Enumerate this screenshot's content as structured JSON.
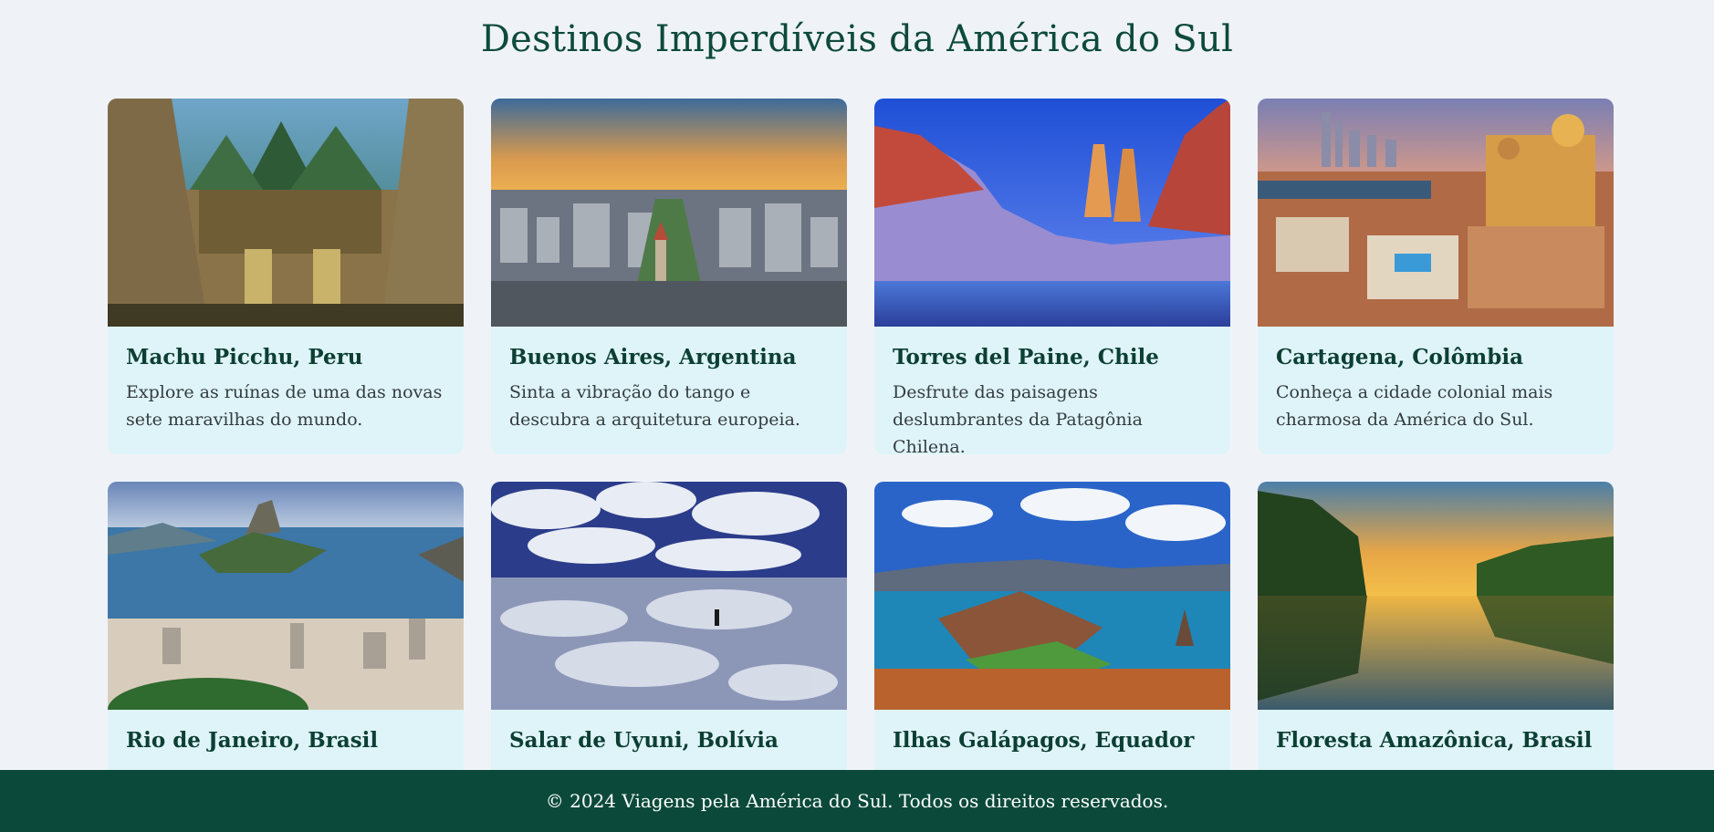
{
  "page": {
    "title": "Destinos Imperdíveis da América do Sul"
  },
  "colors": {
    "background": "#eff3f8",
    "title": "#0d4a3a",
    "card_background": "#dff4f8",
    "card_title": "#0c3f34",
    "footer_background": "#0b4a3a",
    "footer_text": "#ffffff"
  },
  "destinations": [
    {
      "name": "Machu Picchu, Peru",
      "description": "Explore as ruínas de uma das novas sete maravilhas do mundo.",
      "image": "machu-picchu-ruins-photo"
    },
    {
      "name": "Buenos Aires, Argentina",
      "description": "Sinta a vibração do tango e descubra a arquitetura europeia.",
      "image": "buenos-aires-skyline-photo"
    },
    {
      "name": "Torres del Paine, Chile",
      "description": "Desfrute das paisagens deslumbrantes da Patagônia Chilena.",
      "image": "torres-del-paine-mountains-photo"
    },
    {
      "name": "Cartagena, Colômbia",
      "description": "Conheça a cidade colonial mais charmosa da América do Sul.",
      "image": "cartagena-colonial-city-photo"
    },
    {
      "name": "Rio de Janeiro, Brasil",
      "description": "",
      "image": "rio-sugarloaf-bay-photo"
    },
    {
      "name": "Salar de Uyuni, Bolívia",
      "description": "",
      "image": "salar-de-uyuni-mirror-photo"
    },
    {
      "name": "Ilhas Galápagos, Equador",
      "description": "",
      "image": "galapagos-islands-photo"
    },
    {
      "name": "Floresta Amazônica, Brasil",
      "description": "",
      "image": "amazon-river-sunset-photo"
    }
  ],
  "footer": {
    "text": "© 2024 Viagens pela América do Sul. Todos os direitos reservados."
  }
}
